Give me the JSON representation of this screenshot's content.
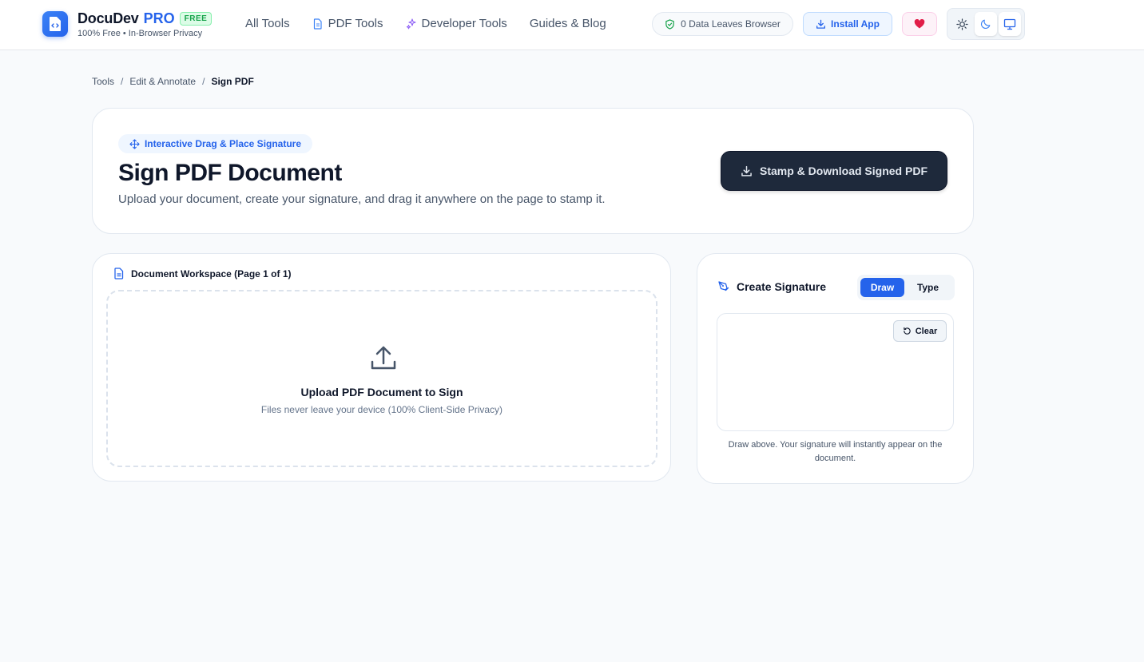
{
  "header": {
    "brand_name": "DocuDev",
    "brand_pro": "PRO",
    "brand_badge": "FREE",
    "brand_sub": "100% Free • In-Browser Privacy",
    "nav": [
      {
        "label": "All Tools"
      },
      {
        "label": "PDF Tools",
        "icon": "file-icon"
      },
      {
        "label": "Developer Tools",
        "icon": "sparkle-icon"
      },
      {
        "label": "Guides & Blog"
      }
    ],
    "privacy_pill": "0 Data Leaves Browser",
    "install_label": "Install App",
    "accent": "#2563eb"
  },
  "breadcrumb": {
    "items": [
      "Tools",
      "Edit & Annotate",
      "Sign PDF"
    ],
    "separator": "/"
  },
  "hero": {
    "badge": "Interactive Drag & Place Signature",
    "title": "Sign PDF Document",
    "subtitle": "Upload your document, create your signature, and drag it anywhere on the page to stamp it.",
    "primary_button": "Stamp & Download Signed PDF"
  },
  "workspace": {
    "title": "Document Workspace (Page 1 of 1)",
    "upload_title": "Upload PDF Document to Sign",
    "upload_sub": "Files never leave your device (100% Client-Side Privacy)"
  },
  "signature": {
    "title": "Create Signature",
    "tabs": [
      "Draw",
      "Type"
    ],
    "active_tab": "Draw",
    "clear_label": "Clear",
    "help": "Draw above. Your signature will instantly appear on the document."
  }
}
